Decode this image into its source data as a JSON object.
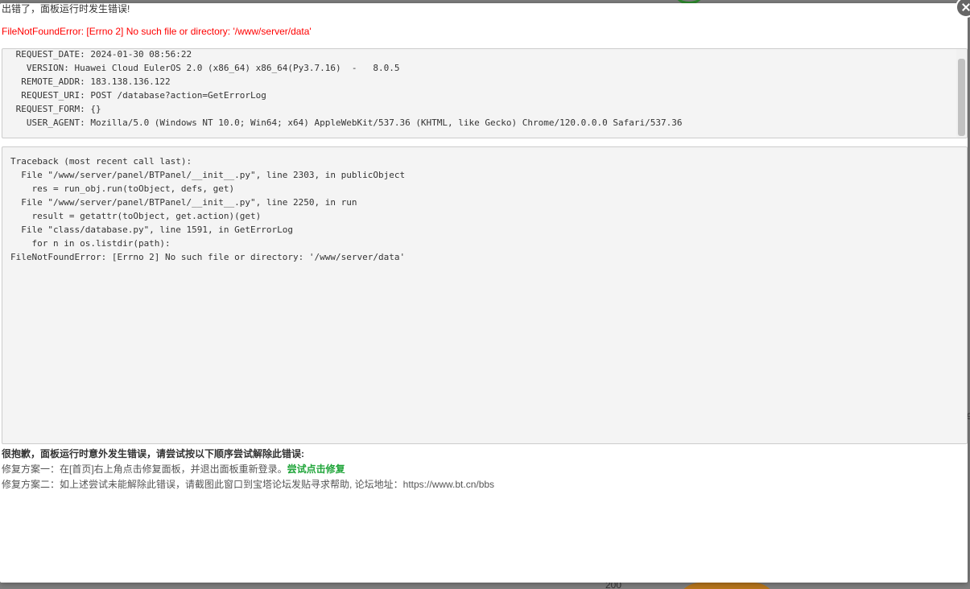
{
  "background": {
    "axis_value": "200",
    "side_mark": "9"
  },
  "modal": {
    "title": "出错了，面板运行时发生错误!",
    "error_line": "FileNotFoundError: [Errno 2] No such file or directory: '/www/server/data'",
    "request_info": [
      " REQUEST_DATE: 2024-01-30 08:56:22",
      "   VERSION: Huawei Cloud EulerOS 2.0 (x86_64) x86_64(Py3.7.16)  -   8.0.5",
      "  REMOTE_ADDR: 183.138.136.122",
      "  REQUEST_URI: POST /database?action=GetErrorLog",
      " REQUEST_FORM: {}",
      "   USER_AGENT: Mozilla/5.0 (Windows NT 10.0; Win64; x64) AppleWebKit/537.36 (KHTML, like Gecko) Chrome/120.0.0.0 Safari/537.36"
    ],
    "traceback": [
      "Traceback (most recent call last):",
      "  File \"/www/server/panel/BTPanel/__init__.py\", line 2303, in publicObject",
      "    res = run_obj.run(toObject, defs, get)",
      "  File \"/www/server/panel/BTPanel/__init__.py\", line 2250, in run",
      "    result = getattr(toObject, get.action)(get)",
      "  File \"class/database.py\", line 1591, in GetErrorLog",
      "    for n in os.listdir(path):",
      "FileNotFoundError: [Errno 2] No such file or directory: '/www/server/data'"
    ],
    "help": {
      "heading": "很抱歉，面板运行时意外发生错误，请尝试按以下顺序尝试解除此错误:",
      "fix1_text": "修复方案一：在[首页]右上角点击修复面板，并退出面板重新登录。",
      "fix1_link": "尝试点击修复",
      "fix2_text": "修复方案二：如上述尝试未能解除此错误，请截图此窗口到宝塔论坛发贴寻求帮助, 论坛地址：https://www.bt.cn/bbs"
    },
    "colors": {
      "error": "#ff0000",
      "link_green": "#20a53a"
    }
  }
}
